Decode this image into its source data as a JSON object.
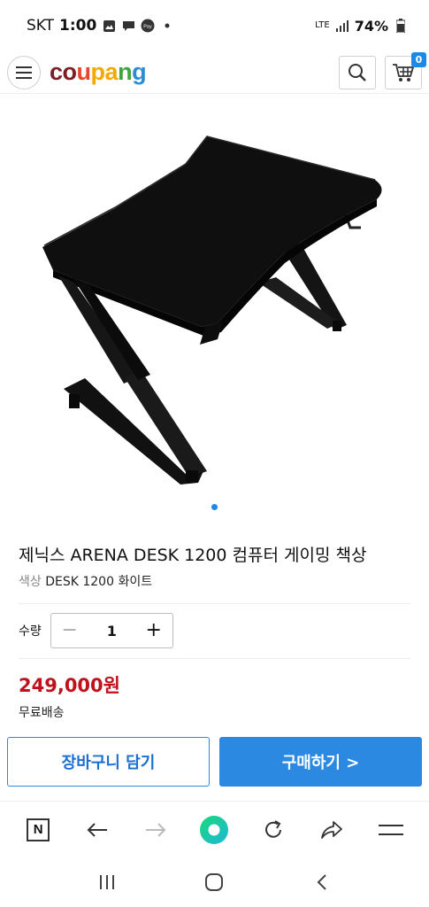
{
  "status_bar": {
    "carrier": "SKT",
    "time": "1:00",
    "network": "LTE",
    "battery": "74%"
  },
  "header": {
    "logo": {
      "c": "cou",
      "p": "pang",
      "colors": [
        "#7b1f24",
        "#e9452d",
        "#f2a900",
        "#3fa33f",
        "#2a8dd4"
      ]
    },
    "cart_count": "0"
  },
  "product": {
    "image_icon": "gaming-desk-photo",
    "title": "제닉스 ARENA DESK 1200 컴퓨터 게이밍 책상",
    "option_label": "색상",
    "option_value": "DESK 1200 화이트",
    "quantity_label": "수량",
    "quantity": "1",
    "price": "249,000원",
    "shipping": "무료배송",
    "carousel_active_color": "#1b8ae6"
  },
  "actions": {
    "add_to_cart": "장바구니 담기",
    "buy_now": "구매하기 >"
  },
  "browser_toolbar": {
    "icons": [
      "naver-icon",
      "back-arrow-icon",
      "forward-arrow-icon",
      "green-dot-icon",
      "refresh-icon",
      "share-icon",
      "menu-icon"
    ]
  },
  "nav_bar": {
    "icons": [
      "recent-apps-icon",
      "home-icon",
      "back-icon"
    ]
  }
}
